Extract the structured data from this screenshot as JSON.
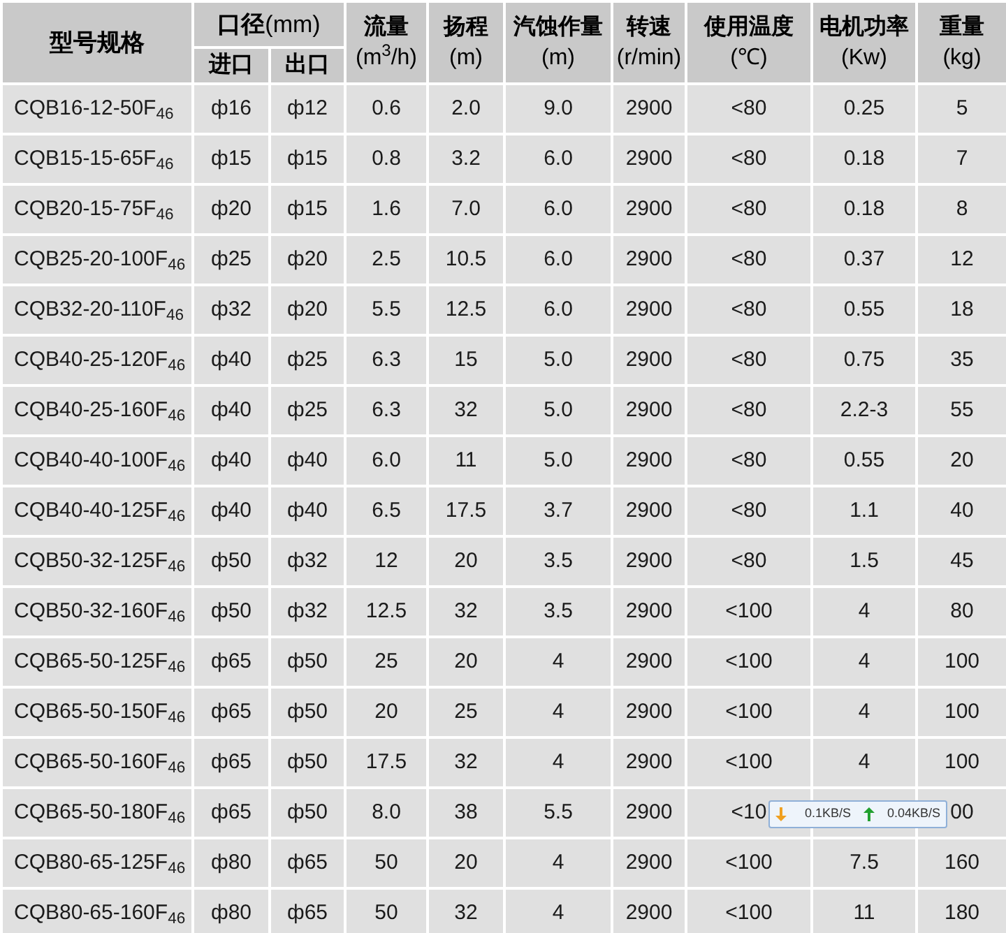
{
  "header": {
    "model": "型号规格",
    "bore": "**口径**(mm)",
    "bore_sub": [
      "进口",
      "出口"
    ],
    "columns": [
      {
        "title": "流量",
        "unit": "(m$^{3}$/h)"
      },
      {
        "title": "扬程",
        "unit": "(m)"
      },
      {
        "title": "汽蚀作量",
        "unit": "(m)"
      },
      {
        "title": "转速",
        "unit": "(r/min)"
      },
      {
        "title": "使用温度",
        "unit": "(℃)"
      },
      {
        "title": "电机功率",
        "unit": "(Kw)"
      },
      {
        "title": "重量",
        "unit": "(kg)"
      }
    ]
  },
  "rows": [
    {
      "cells": [
        "CQB16-12-50F$_{46}$",
        "ф16",
        "ф12",
        "0.6",
        "2.0",
        "9.0",
        "2900",
        "<80",
        "0.25",
        "5"
      ]
    },
    {
      "cells": [
        "CQB15-15-65F$_{46}$",
        "ф15",
        "ф15",
        "0.8",
        "3.2",
        "6.0",
        "2900",
        "<80",
        "0.18",
        "7"
      ]
    },
    {
      "cells": [
        "CQB20-15-75F$_{46}$",
        "ф20",
        "ф15",
        "1.6",
        "7.0",
        "6.0",
        "2900",
        "<80",
        "0.18",
        "8"
      ]
    },
    {
      "cells": [
        "CQB25-20-100F$_{46}$",
        "ф25",
        "ф20",
        "2.5",
        "10.5",
        "6.0",
        "2900",
        "<80",
        "0.37",
        "12"
      ]
    },
    {
      "cells": [
        "CQB32-20-110F$_{46}$",
        "ф32",
        "ф20",
        "5.5",
        "12.5",
        "6.0",
        "2900",
        "<80",
        "0.55",
        "18"
      ]
    },
    {
      "cells": [
        "CQB40-25-120F$_{46}$",
        "ф40",
        "ф25",
        "6.3",
        "15",
        "5.0",
        "2900",
        "<80",
        "0.75",
        "35"
      ]
    },
    {
      "cells": [
        "CQB40-25-160F$_{46}$",
        "ф40",
        "ф25",
        "6.3",
        "32",
        "5.0",
        "2900",
        "<80",
        "2.2-3",
        "55"
      ]
    },
    {
      "cells": [
        "CQB40-40-100F$_{46}$",
        "ф40",
        "ф40",
        "6.0",
        "11",
        "5.0",
        "2900",
        "<80",
        "0.55",
        "20"
      ]
    },
    {
      "cells": [
        "CQB40-40-125F$_{46}$",
        "ф40",
        "ф40",
        "6.5",
        "17.5",
        "3.7",
        "2900",
        "<80",
        "1.1",
        "40"
      ]
    },
    {
      "cells": [
        "CQB50-32-125F$_{46}$",
        "ф50",
        "ф32",
        "12",
        "20",
        "3.5",
        "2900",
        "<80",
        "1.5",
        "45"
      ]
    },
    {
      "cells": [
        "CQB50-32-160F$_{46}$",
        "ф50",
        "ф32",
        "12.5",
        "32",
        "3.5",
        "2900",
        "<100",
        "4",
        "80"
      ]
    },
    {
      "cells": [
        "CQB65-50-125F$_{46}$",
        "ф65",
        "ф50",
        "25",
        "20",
        "4",
        "2900",
        "<100",
        "4",
        "100"
      ]
    },
    {
      "cells": [
        "CQB65-50-150F$_{46}$",
        "ф65",
        "ф50",
        "20",
        "25",
        "4",
        "2900",
        "<100",
        "4",
        "100"
      ]
    },
    {
      "cells": [
        "CQB65-50-160F$_{46}$",
        "ф65",
        "ф50",
        "17.5",
        "32",
        "4",
        "2900",
        "<100",
        "4",
        "100"
      ]
    },
    {
      "cells": [
        "CQB65-50-180F$_{46}$",
        "ф65",
        "ф50",
        "8.0",
        "38",
        "5.5",
        "2900",
        "<10",
        null,
        "00"
      ]
    },
    {
      "cells": [
        "CQB80-65-125F$_{46}$",
        "ф80",
        "ф65",
        "50",
        "20",
        "4",
        "2900",
        "<100",
        "7.5",
        "160"
      ]
    },
    {
      "cells": [
        "CQB80-65-160F$_{46}$",
        "ф80",
        "ф65",
        "50",
        "32",
        "4",
        "2900",
        "<100",
        "11",
        "180"
      ]
    }
  ],
  "speed_widget": {
    "download": "0.1KB/S",
    "upload": "0.04KB/S"
  }
}
